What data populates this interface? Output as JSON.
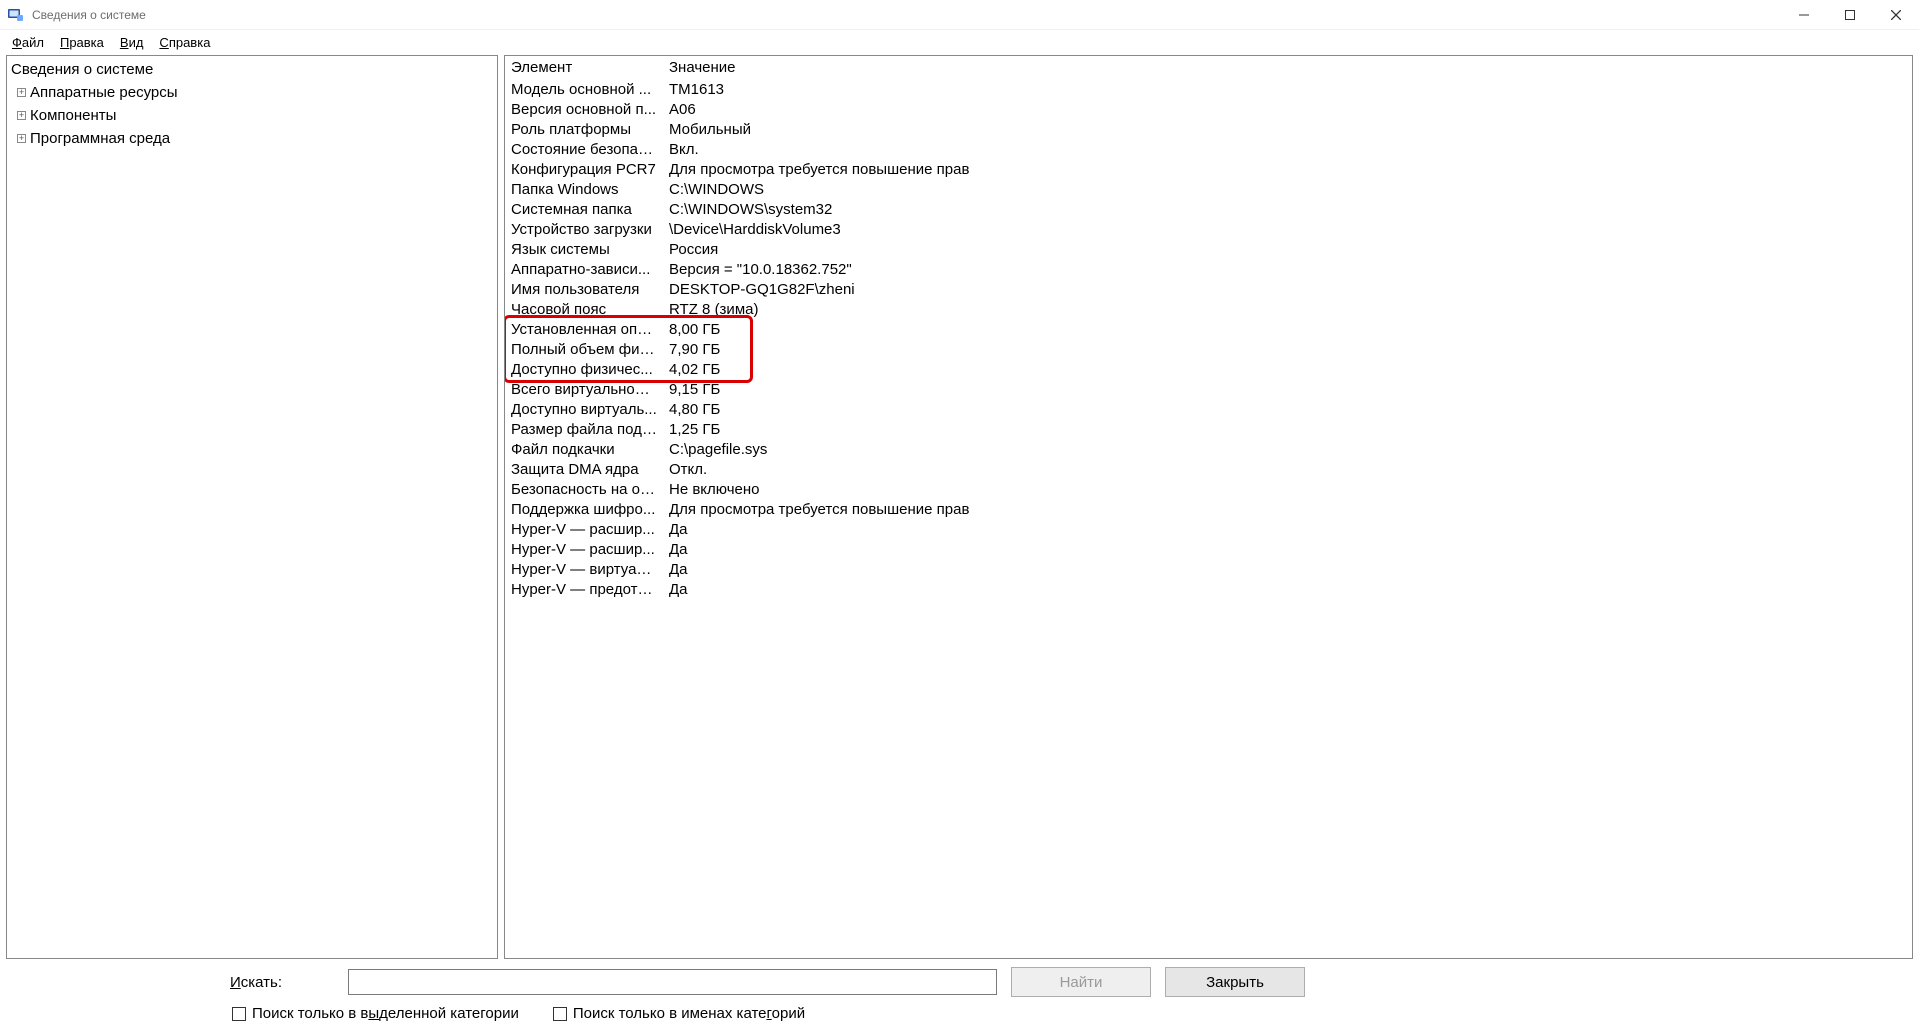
{
  "titlebar": {
    "title": "Сведения о системе"
  },
  "menubar": {
    "file": {
      "label": "Файл",
      "uidx": 0
    },
    "edit": {
      "label": "Правка",
      "uidx": 0
    },
    "view": {
      "label": "Вид",
      "uidx": 0
    },
    "help": {
      "label": "Справка",
      "uidx": 0
    }
  },
  "tree": {
    "root": "Сведения о системе",
    "children": [
      {
        "label": "Аппаратные ресурсы"
      },
      {
        "label": "Компоненты"
      },
      {
        "label": "Программная среда"
      }
    ]
  },
  "details": {
    "headers": {
      "element": "Элемент",
      "value": "Значение"
    },
    "rows": [
      {
        "element": "Модель основной ...",
        "value": "TM1613"
      },
      {
        "element": "Версия основной п...",
        "value": "A06"
      },
      {
        "element": "Роль платформы",
        "value": "Мобильный"
      },
      {
        "element": "Состояние безопас...",
        "value": "Вкл."
      },
      {
        "element": "Конфигурация PCR7",
        "value": "Для просмотра требуется повышение прав"
      },
      {
        "element": "Папка Windows",
        "value": "C:\\WINDOWS"
      },
      {
        "element": "Системная папка",
        "value": "C:\\WINDOWS\\system32"
      },
      {
        "element": "Устройство загрузки",
        "value": "\\Device\\HarddiskVolume3"
      },
      {
        "element": "Язык системы",
        "value": "Россия"
      },
      {
        "element": "Аппаратно-зависи...",
        "value": "Версия = \"10.0.18362.752\""
      },
      {
        "element": "Имя пользователя",
        "value": "DESKTOP-GQ1G82F\\zheni"
      },
      {
        "element": "Часовой пояс",
        "value": "RTZ 8 (зима)"
      },
      {
        "element": "Установленная опе...",
        "value": "8,00 ГБ",
        "hl": true
      },
      {
        "element": "Полный объем физ...",
        "value": "7,90 ГБ",
        "hl": true
      },
      {
        "element": "Доступно физичес...",
        "value": "4,02 ГБ",
        "hl": true
      },
      {
        "element": "Всего виртуальной ...",
        "value": "9,15 ГБ"
      },
      {
        "element": "Доступно виртуаль...",
        "value": "4,80 ГБ"
      },
      {
        "element": "Размер файла подк...",
        "value": "1,25 ГБ"
      },
      {
        "element": "Файл подкачки",
        "value": "C:\\pagefile.sys"
      },
      {
        "element": "Защита DMA ядра",
        "value": "Откл."
      },
      {
        "element": "Безопасность на ос...",
        "value": "Не включено"
      },
      {
        "element": "Поддержка шифро...",
        "value": "Для просмотра требуется повышение прав"
      },
      {
        "element": "Hyper-V — расшир...",
        "value": "Да"
      },
      {
        "element": "Hyper-V — расшир...",
        "value": "Да"
      },
      {
        "element": "Hyper-V — виртуал...",
        "value": "Да"
      },
      {
        "element": "Hyper-V — предотв...",
        "value": "Да"
      }
    ]
  },
  "search": {
    "label": "Искать:",
    "find": "Найти",
    "close": "Закрыть",
    "cb_selected_category": "Поиск только в выделенной категории",
    "cb_selected_category_uidx": 16,
    "cb_category_names": "Поиск только в именах категорий",
    "cb_category_names_uidx": 26
  }
}
